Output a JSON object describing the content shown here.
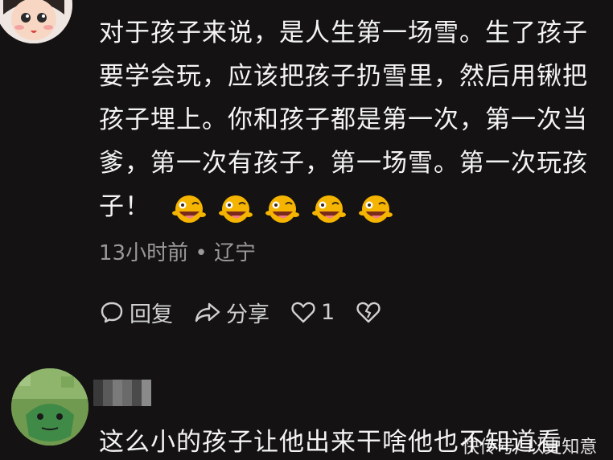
{
  "comment": {
    "lines": [
      "对于孩子来说，是人生第一场雪。生了孩子",
      "要学会玩，应该把孩子扔雪里，然后用锹把",
      "孩子埋上。你和孩子都是第一次，第一次当",
      "爹，第一次有孩子，第一场雪。第一次玩孩",
      "子！"
    ],
    "emoji_count": 5,
    "emoji_icon": "zany-face-icon",
    "meta": "13小时前 • 辽宁"
  },
  "actions": {
    "reply_label": "回复",
    "share_label": "分享",
    "like_count": "1"
  },
  "reply": {
    "text": "这么小的孩子让他出来干啥他也不知道看"
  },
  "watermark": "快传号/ 以史知意",
  "colors": {
    "background": "#141212",
    "text": "#f4f4f4",
    "meta": "#9a9a9a",
    "emoji": "#f5b400"
  }
}
